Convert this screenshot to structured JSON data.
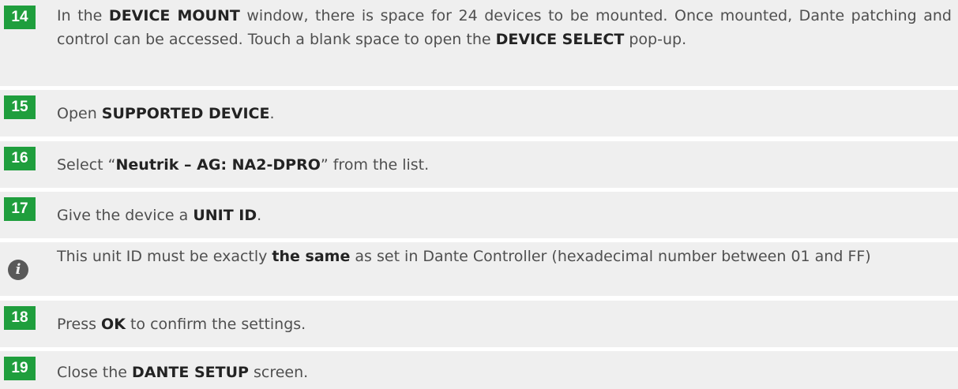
{
  "steps": [
    {
      "number": "14",
      "parts": [
        "In the ",
        "DEVICE MOUNT",
        " window, there is space for 24 devices to be mounted. Once mounted, Dante patching and control can be accessed. Touch a blank space to open the ",
        "DEVICE SELECT",
        " pop-up."
      ]
    },
    {
      "number": "15",
      "parts": [
        "Open ",
        "SUPPORTED DEVICE",
        "."
      ]
    },
    {
      "number": "16",
      "parts": [
        "Select “",
        "Neutrik – AG: NA2-DPRO",
        "” from the list."
      ]
    },
    {
      "number": "17",
      "parts": [
        "Give the device a ",
        "UNIT ID",
        "."
      ]
    },
    {
      "icon": "info-icon",
      "parts": [
        "This unit ID must be exactly ",
        "the same",
        " as set in Dante Controller (hexadecimal number between 01 and FF)"
      ]
    },
    {
      "number": "18",
      "parts": [
        "Press ",
        "OK",
        " to confirm the settings."
      ]
    },
    {
      "number": "19",
      "parts": [
        "Close the ",
        "DANTE SETUP",
        " screen."
      ]
    }
  ],
  "colors": {
    "badge": "#1f9e3d",
    "row_background": "#efefef",
    "text": "#4f4f4f",
    "bold_text": "#232323"
  }
}
